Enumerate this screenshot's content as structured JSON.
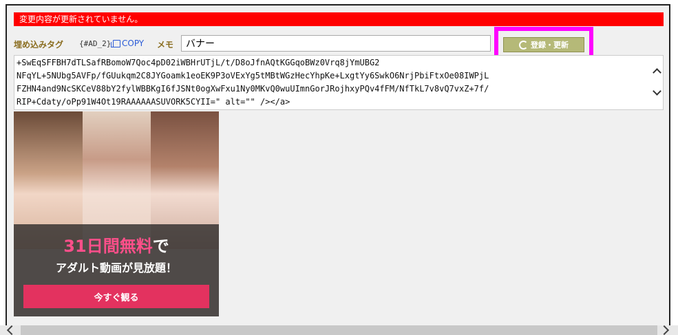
{
  "alert": {
    "message": "変更内容が更新されていません。"
  },
  "tag_row": {
    "label": "埋め込みタグ",
    "code": "{#AD_2}",
    "copy_label": "COPY",
    "memo_label": "メモ",
    "memo_value": "バナー"
  },
  "update_button": {
    "label": "登録・更新"
  },
  "code": {
    "lines": [
      "+SwEqSFFBH7dTLSafRBomoW7Qoc4pD02iWBHrUTjL/t/D8oJfnAQtKGGqoBWz0Vrq8jYmUBG2",
      "NFqYL+5NUbg5AVFp/fGUukqm2C8JYGoamk1eoEK9P3oVExYg5tMBtWGzHecYhpKe+LxgtYy6SwkO6NrjPbiFtxOe08IWPjL",
      "FZHN4and9NcSKCeV88bY2fylWBBKgI6fJSNt0ogXwFxu1Ny0MKvQ0wuUImnGorJRojhxyPQv4fFM/NfTkL7v8vQ7vxZ+7f/",
      "RIP+Cdaty/oPp91W4Ot19RAAAAAASUVORK5CYII=\" alt=\"\" /></a>"
    ]
  },
  "banner": {
    "headline_pink": "31日間無料",
    "headline_white": "で",
    "subline": "アダルト動画が見放題！",
    "cta": "今すぐ観る"
  },
  "colors": {
    "alert": "#ff0000",
    "highlight": "#ff00ff",
    "button": "#b5b978",
    "cta": "#e3325f"
  }
}
